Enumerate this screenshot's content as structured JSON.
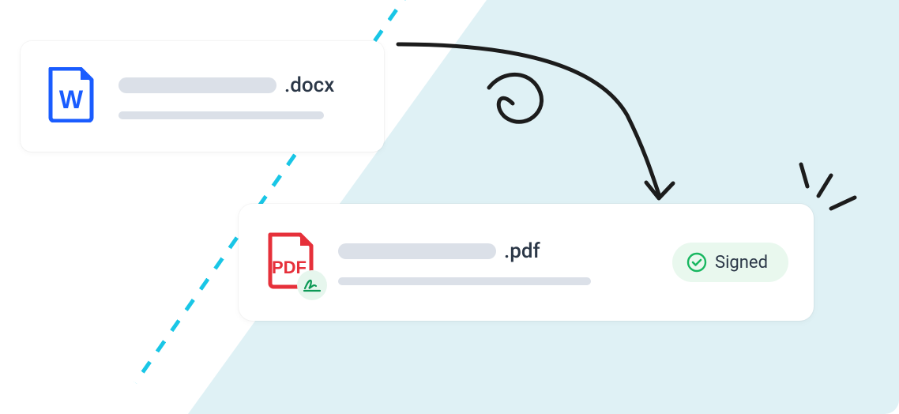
{
  "source": {
    "icon_letter": "W",
    "extension": ".docx"
  },
  "target": {
    "icon_label": "PDF",
    "extension": ".pdf"
  },
  "status": {
    "label": "Signed"
  }
}
